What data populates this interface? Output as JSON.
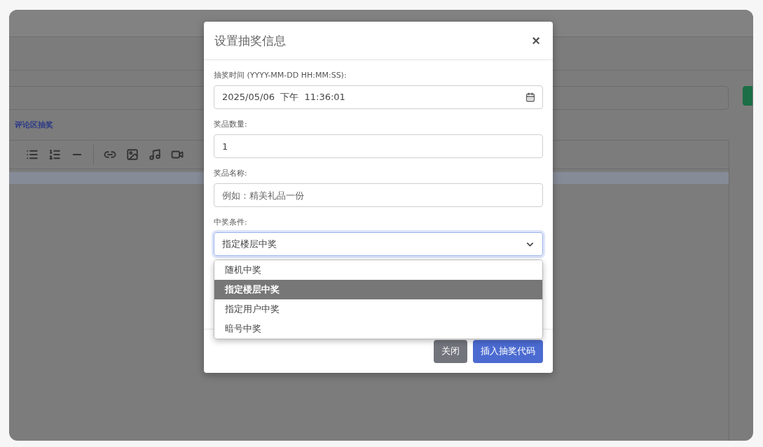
{
  "background": {
    "link": "评论区抽奖"
  },
  "modal": {
    "title": "设置抽奖信息",
    "close": "×",
    "fields": [
      {
        "kind": "date",
        "label": "抽奖时间 (YYYY-MM-DD HH:MM:SS):",
        "value": "2025/05/06  下午  11:36:01"
      },
      {
        "kind": "text",
        "label": "奖品数量:",
        "value": "1"
      },
      {
        "kind": "text",
        "label": "奖品名称:",
        "placeholder": "例如：精美礼品一份"
      },
      {
        "kind": "select",
        "label": "中奖条件:",
        "value": "指定楼层中奖",
        "focused": true,
        "expanded": true,
        "options": [
          {
            "label": "随机中奖",
            "selected": false
          },
          {
            "label": "指定楼层中奖",
            "selected": true
          },
          {
            "label": "指定用户中奖",
            "selected": false
          },
          {
            "label": "暗号中奖",
            "selected": false
          }
        ]
      }
    ],
    "buttons": [
      {
        "kind": "secondary",
        "label": "关闭"
      },
      {
        "kind": "primary",
        "label": "插入抽奖代码"
      }
    ]
  }
}
